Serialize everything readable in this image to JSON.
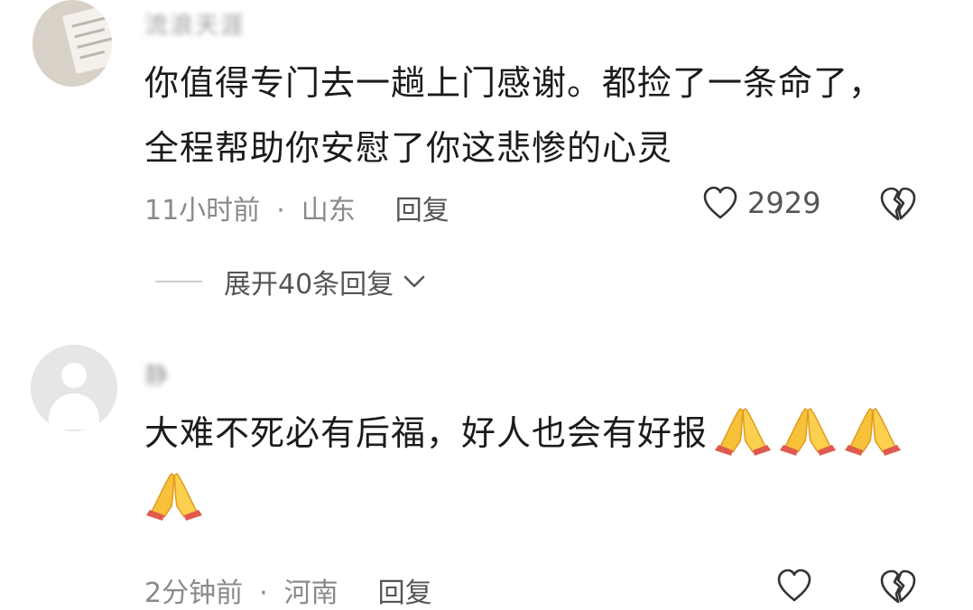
{
  "comments": [
    {
      "username": "流浪天涯",
      "text_lines": [
        "你值得专门去一趟上门感谢。都捡了一条命了，",
        "全程帮助你安慰了你这悲惨的心灵"
      ],
      "time": "11小时前",
      "separator": "·",
      "location": "山东",
      "reply_label": "回复",
      "like_count": "2929",
      "expand_label": "展开40条回复"
    },
    {
      "username": "静",
      "text": "大难不死必有后福，好人也会有好报",
      "emojis": [
        "folded-hands-emoji",
        "folded-hands-emoji",
        "folded-hands-emoji",
        "folded-hands-emoji"
      ],
      "time": "2分钟前",
      "separator": "·",
      "location": "河南",
      "reply_label": "回复"
    }
  ],
  "colors": {
    "text": "#1b1b1b",
    "meta": "#8a8a8a",
    "emoji": "#f7c23a"
  }
}
